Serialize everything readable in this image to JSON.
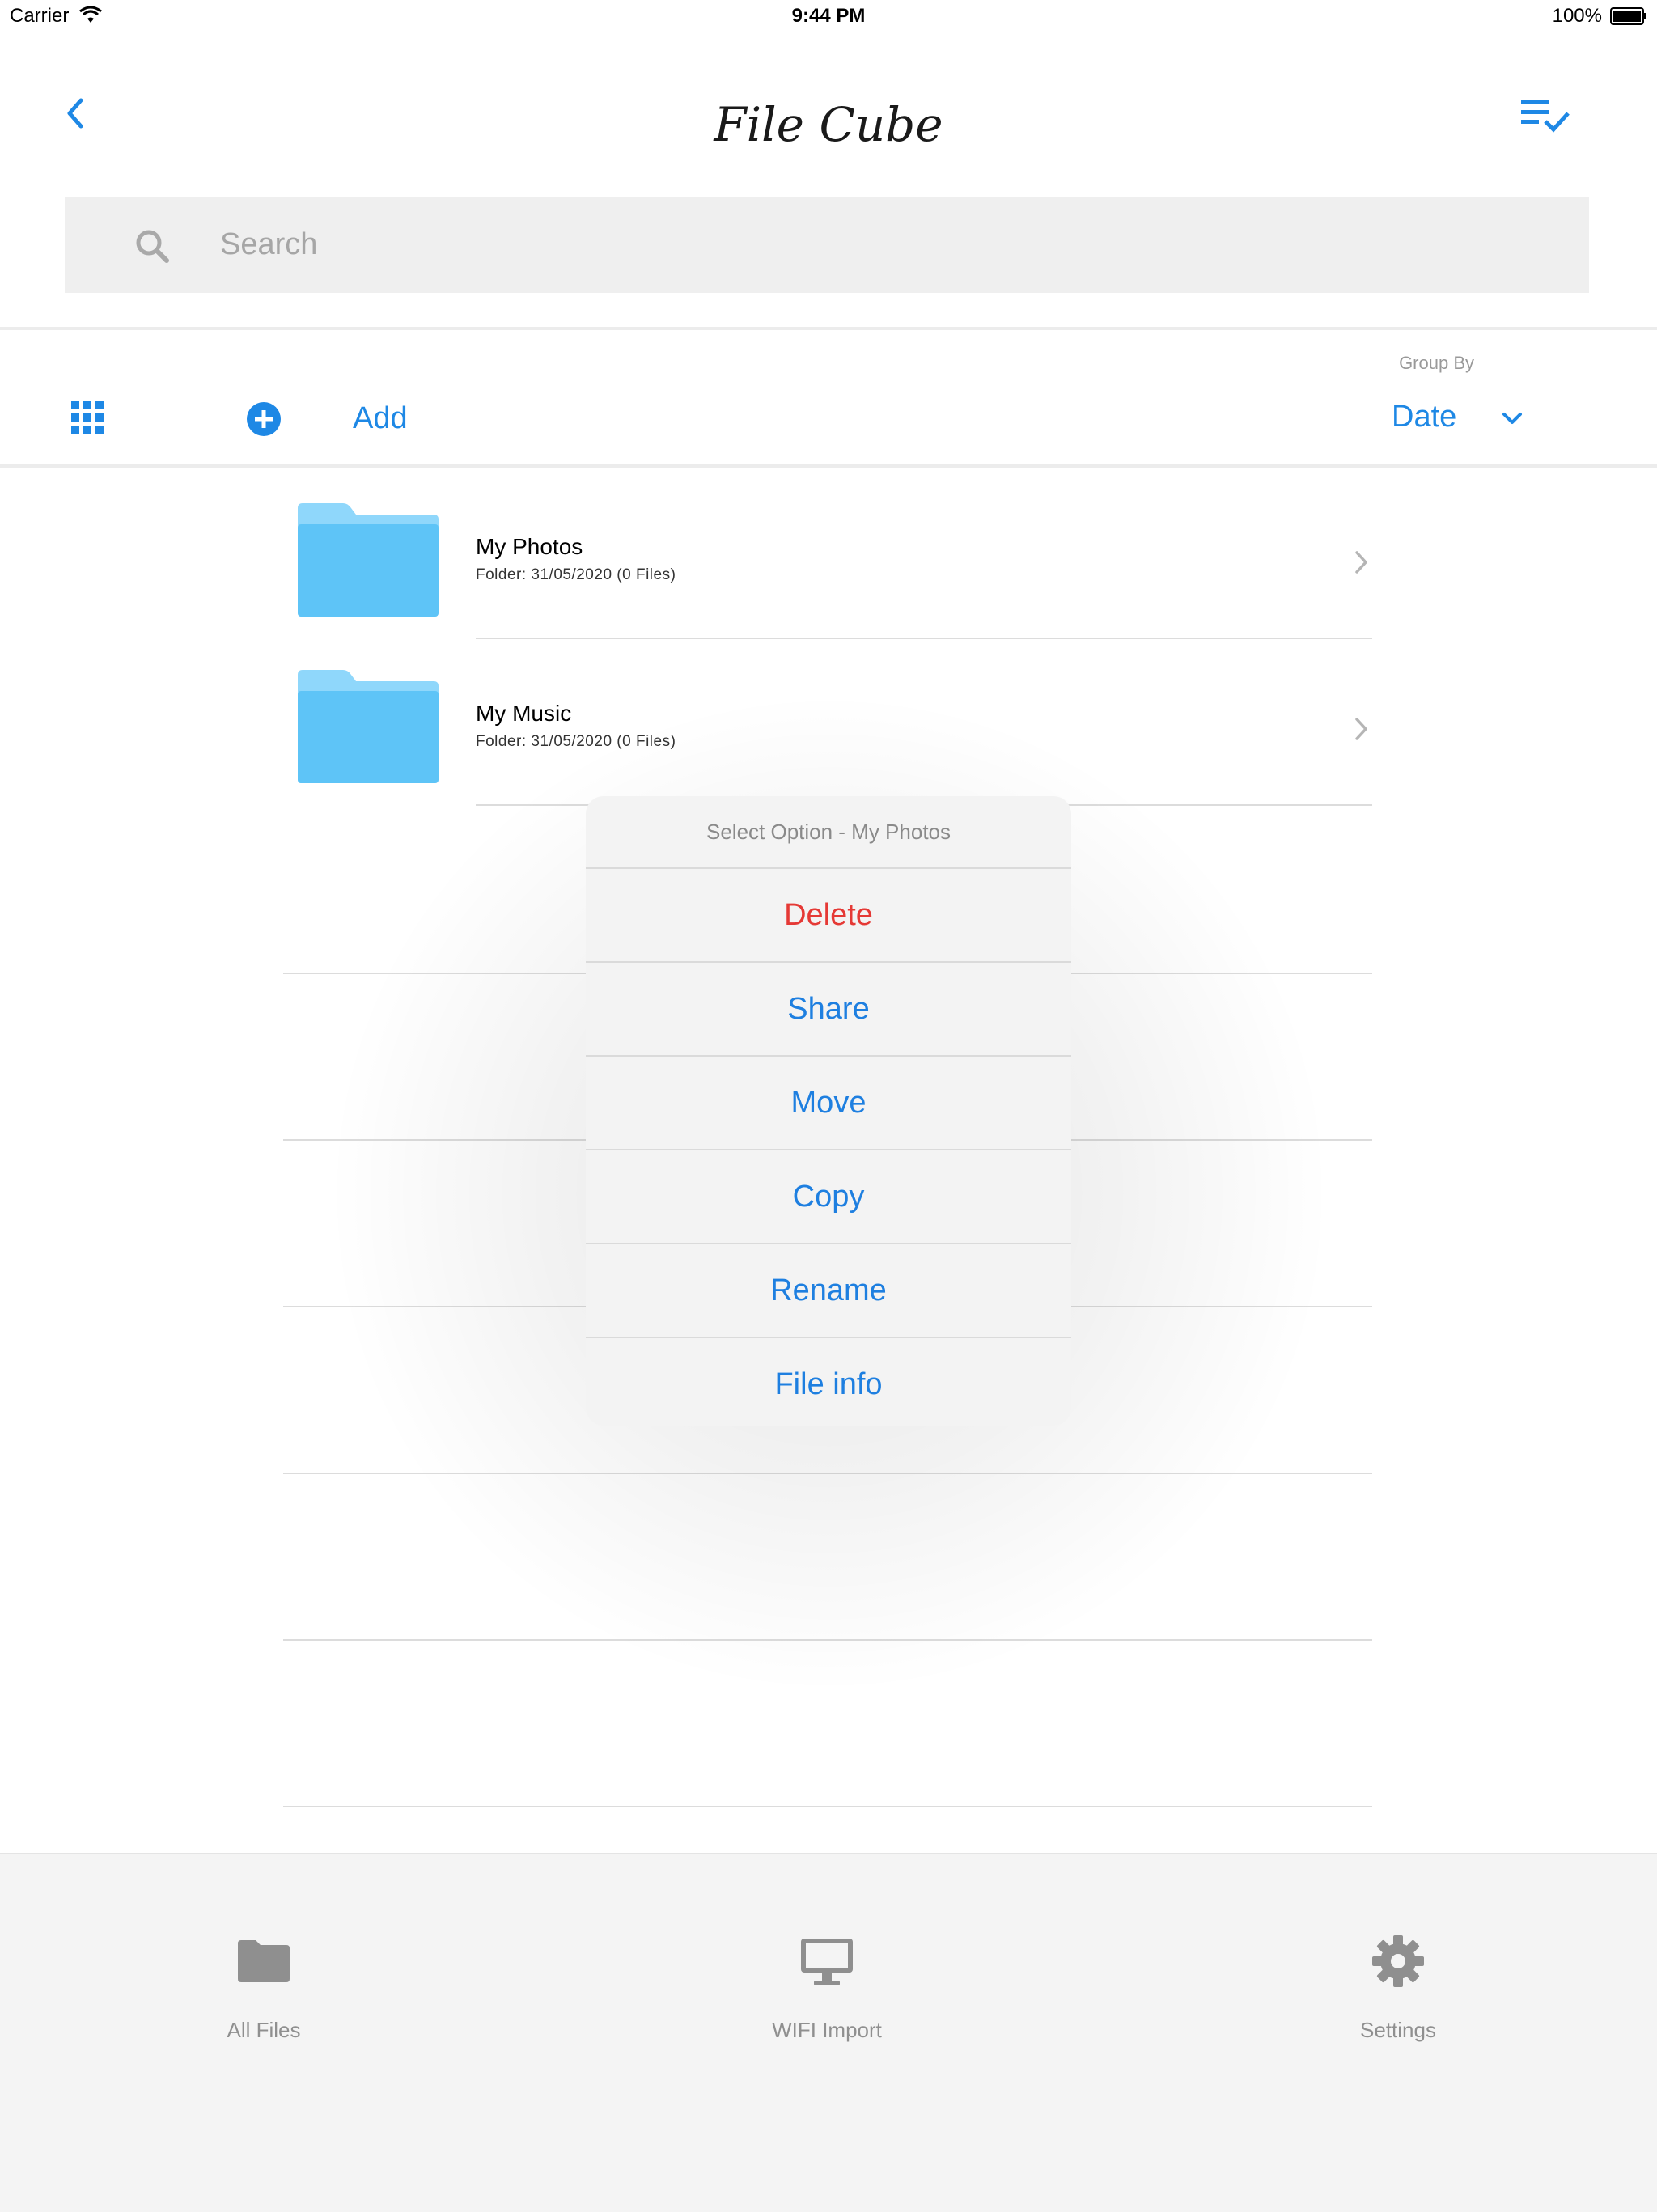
{
  "status_bar": {
    "carrier": "Carrier",
    "time": "9:44 PM",
    "battery": "100%"
  },
  "nav": {
    "title": "File Cube"
  },
  "search": {
    "placeholder": "Search"
  },
  "toolbar": {
    "add_label": "Add",
    "group_by_label": "Group By",
    "group_by_value": "Date"
  },
  "files": [
    {
      "name": "My Photos",
      "subtitle": "Folder: 31/05/2020 (0 Files)"
    },
    {
      "name": "My Music",
      "subtitle": "Folder: 31/05/2020 (0 Files)"
    }
  ],
  "action_sheet": {
    "title": "Select Option - My Photos",
    "options": [
      "Delete",
      "Share",
      "Move",
      "Copy",
      "Rename",
      "File info"
    ]
  },
  "tab_bar": {
    "tabs": [
      "All Files",
      "WIFI Import",
      "Settings"
    ]
  },
  "colors": {
    "accent": "#1e88e5",
    "danger": "#e53935",
    "folder": "#5ec4f7",
    "muted": "#8f8f8f"
  }
}
